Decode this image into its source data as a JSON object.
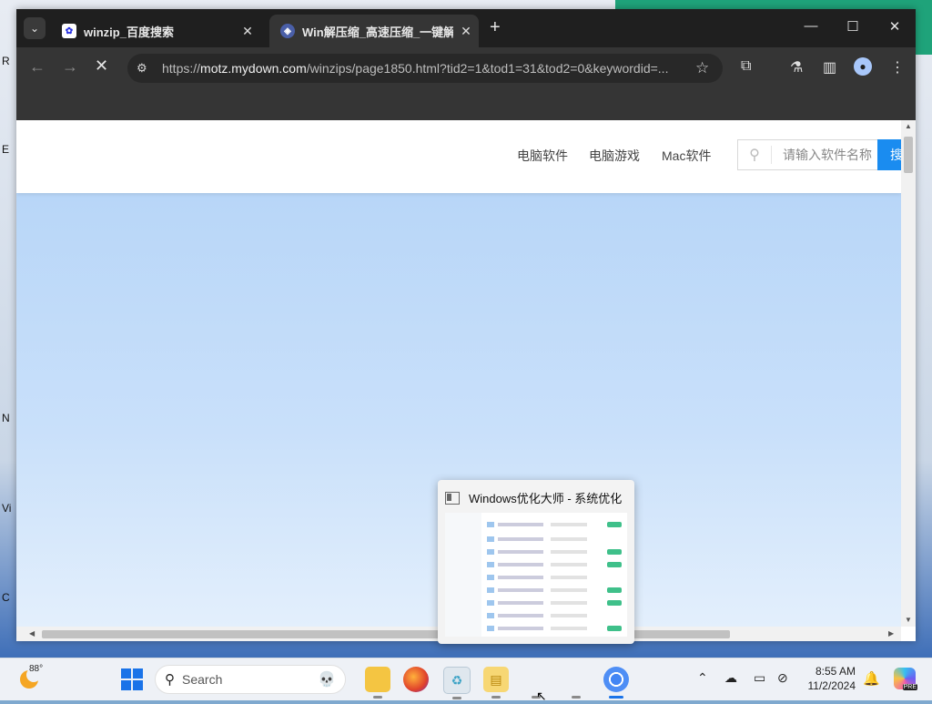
{
  "browser": {
    "tabs": [
      {
        "title": "winzip_百度搜索",
        "favicon": "baidu-paw-icon"
      },
      {
        "title": "Win解压缩_高速压缩_一键解压",
        "favicon": "mydown-icon",
        "active": true
      }
    ],
    "url": {
      "prefix": "https://",
      "domain": "motz.mydown.com",
      "path": "/winzips/page1850.html?tid2=1&tod1=31&tod2=0&keywordid=..."
    }
  },
  "site": {
    "nav": [
      "电脑软件",
      "电脑游戏",
      "Mac软件"
    ],
    "search_placeholder": "请输入软件名称",
    "search_button": "搜"
  },
  "preview": {
    "title": "Windows优化大师 - 系统优化"
  },
  "taskbar": {
    "temperature": "88°",
    "search_label": "Search",
    "time": "8:55 AM",
    "date": "11/2/2024",
    "copilot_badge": "PRE"
  },
  "desktop": {
    "edge_labels": [
      "R",
      "E",
      "N",
      "Vi",
      "C"
    ]
  }
}
